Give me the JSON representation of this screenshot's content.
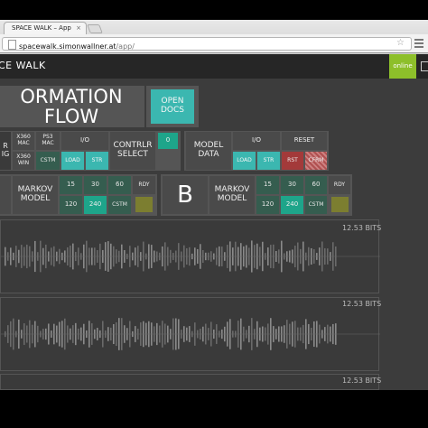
{
  "browser": {
    "tab_title": "SPACE WALK – App",
    "tab_close": "×",
    "url_host": "spacewalk.simonwallner.at",
    "url_path": "/app/",
    "star": "☆"
  },
  "app": {
    "brand": "CE WALK",
    "online": "online"
  },
  "header": {
    "title": "ORMATION FLOW",
    "docs_button": "OPEN DOCS"
  },
  "row1": {
    "left_partial": "R\nIG",
    "x360_mac": "X360\nMAC",
    "ps3_mac": "PS3\nMAC",
    "io_label": "I/O",
    "x360_win": "X360\nWIN",
    "cstm": "CSTM",
    "load": "LOAD",
    "str": "STR",
    "controller_select": "CONTRLR\nSELECT",
    "indicator": "0",
    "model_data": "MODEL\nDATA",
    "io_label2": "I/O",
    "reset": "RESET",
    "load2": "LOAD",
    "str2": "STR",
    "rst": "RST",
    "cfrm": "CFRM"
  },
  "row2": {
    "a_markov": "MARKOV\nMODEL",
    "a_rates": [
      "15",
      "30",
      "60",
      "120",
      "240",
      "CSTM"
    ],
    "a_rdy": "RDY",
    "b_letter": "B",
    "b_markov": "MARKOV\nMODEL",
    "b_rates": [
      "15",
      "30",
      "60",
      "120",
      "240",
      "CSTM"
    ],
    "b_rdy": "RDY"
  },
  "viz": {
    "bits": [
      "12.53 BITS",
      "12.53 BITS",
      "12.53 BITS"
    ]
  },
  "colors": {
    "teal": "#3bb7b0",
    "green_active": "#1ea58a",
    "online_green": "#8dbf2a",
    "reset_red": "#a33a3a"
  }
}
